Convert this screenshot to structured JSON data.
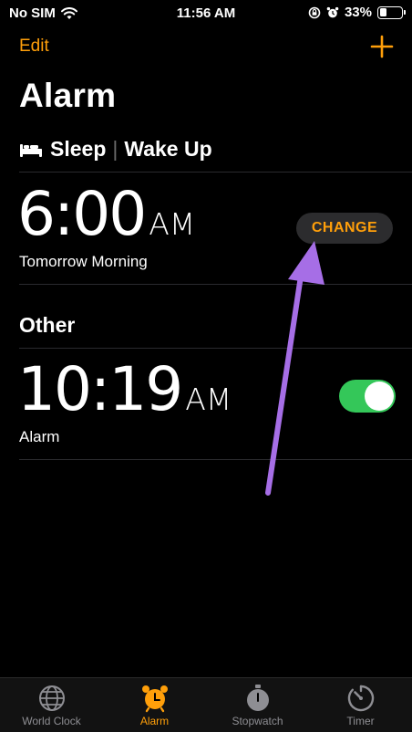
{
  "status_bar": {
    "carrier": "No SIM",
    "time": "11:56 AM",
    "battery": "33%",
    "battery_level": 0.33,
    "icons": [
      "wifi-icon",
      "rotation-lock-icon",
      "alarm-clock-icon",
      "battery-icon"
    ]
  },
  "nav": {
    "edit_label": "Edit",
    "add_icon": "plus-icon"
  },
  "page": {
    "title": "Alarm"
  },
  "sleep": {
    "title": "Sleep",
    "separator": "|",
    "subtitle": "Wake Up",
    "icon": "bed-icon",
    "alarm": {
      "time": "6:00",
      "ampm": "AM",
      "label": "Tomorrow Morning",
      "change_label": "CHANGE"
    }
  },
  "other": {
    "title": "Other",
    "alarms": [
      {
        "time": "10:19",
        "ampm": "AM",
        "label": "Alarm",
        "enabled": true
      }
    ]
  },
  "tabs": [
    {
      "label": "World Clock",
      "icon": "globe-icon",
      "active": false
    },
    {
      "label": "Alarm",
      "icon": "alarm-clock-icon",
      "active": true
    },
    {
      "label": "Stopwatch",
      "icon": "stopwatch-icon",
      "active": false
    },
    {
      "label": "Timer",
      "icon": "timer-icon",
      "active": false
    }
  ],
  "colors": {
    "accent": "#ff9f0a",
    "toggle_on": "#34c759",
    "annotation_arrow": "#a66ee6",
    "background": "#000000"
  }
}
